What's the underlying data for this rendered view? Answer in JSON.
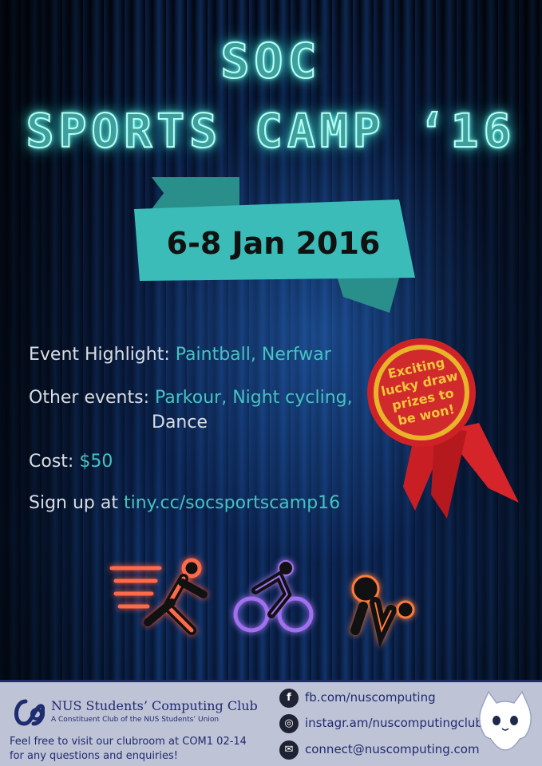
{
  "title": {
    "line1": "SOC",
    "line2": "SPORTS CAMP ‘16"
  },
  "date": "6-8 Jan 2016",
  "details": {
    "highlight_label": "Event Highlight:",
    "highlight_value": "Paintball, Nerfwar",
    "other_label": "Other events:",
    "other_value_1": "Parkour, Night cycling,",
    "other_value_2": "Dance",
    "cost_label": "Cost:",
    "cost_value": "$50",
    "signup_label": "Sign up at",
    "signup_value": "tiny.cc/socsportscamp16"
  },
  "badge": {
    "line1": "Exciting",
    "line2": "lucky draw",
    "line3": "prizes to",
    "line4": "be won!"
  },
  "icons": [
    "runner-icon",
    "cyclist-icon",
    "football-player-icon"
  ],
  "footer": {
    "club_name": "NUS Students’ Computing Club",
    "club_sub": "A Constituent Club of the NUS Students’ Union",
    "visit_line1": "Feel free to visit our clubroom at COM1 02-14",
    "visit_line2": "for any questions and enquiries!",
    "facebook": "fb.com/nuscomputing",
    "instagram": "instagr.am/nuscomputingclub",
    "email": "connect@nuscomputing.com"
  },
  "colors": {
    "teal": "#46c3c0",
    "ribbon": "#3cbcb8",
    "badge_red": "#d5252a",
    "footer_bg": "#bfc3d6",
    "footer_text": "#1e2c70"
  }
}
